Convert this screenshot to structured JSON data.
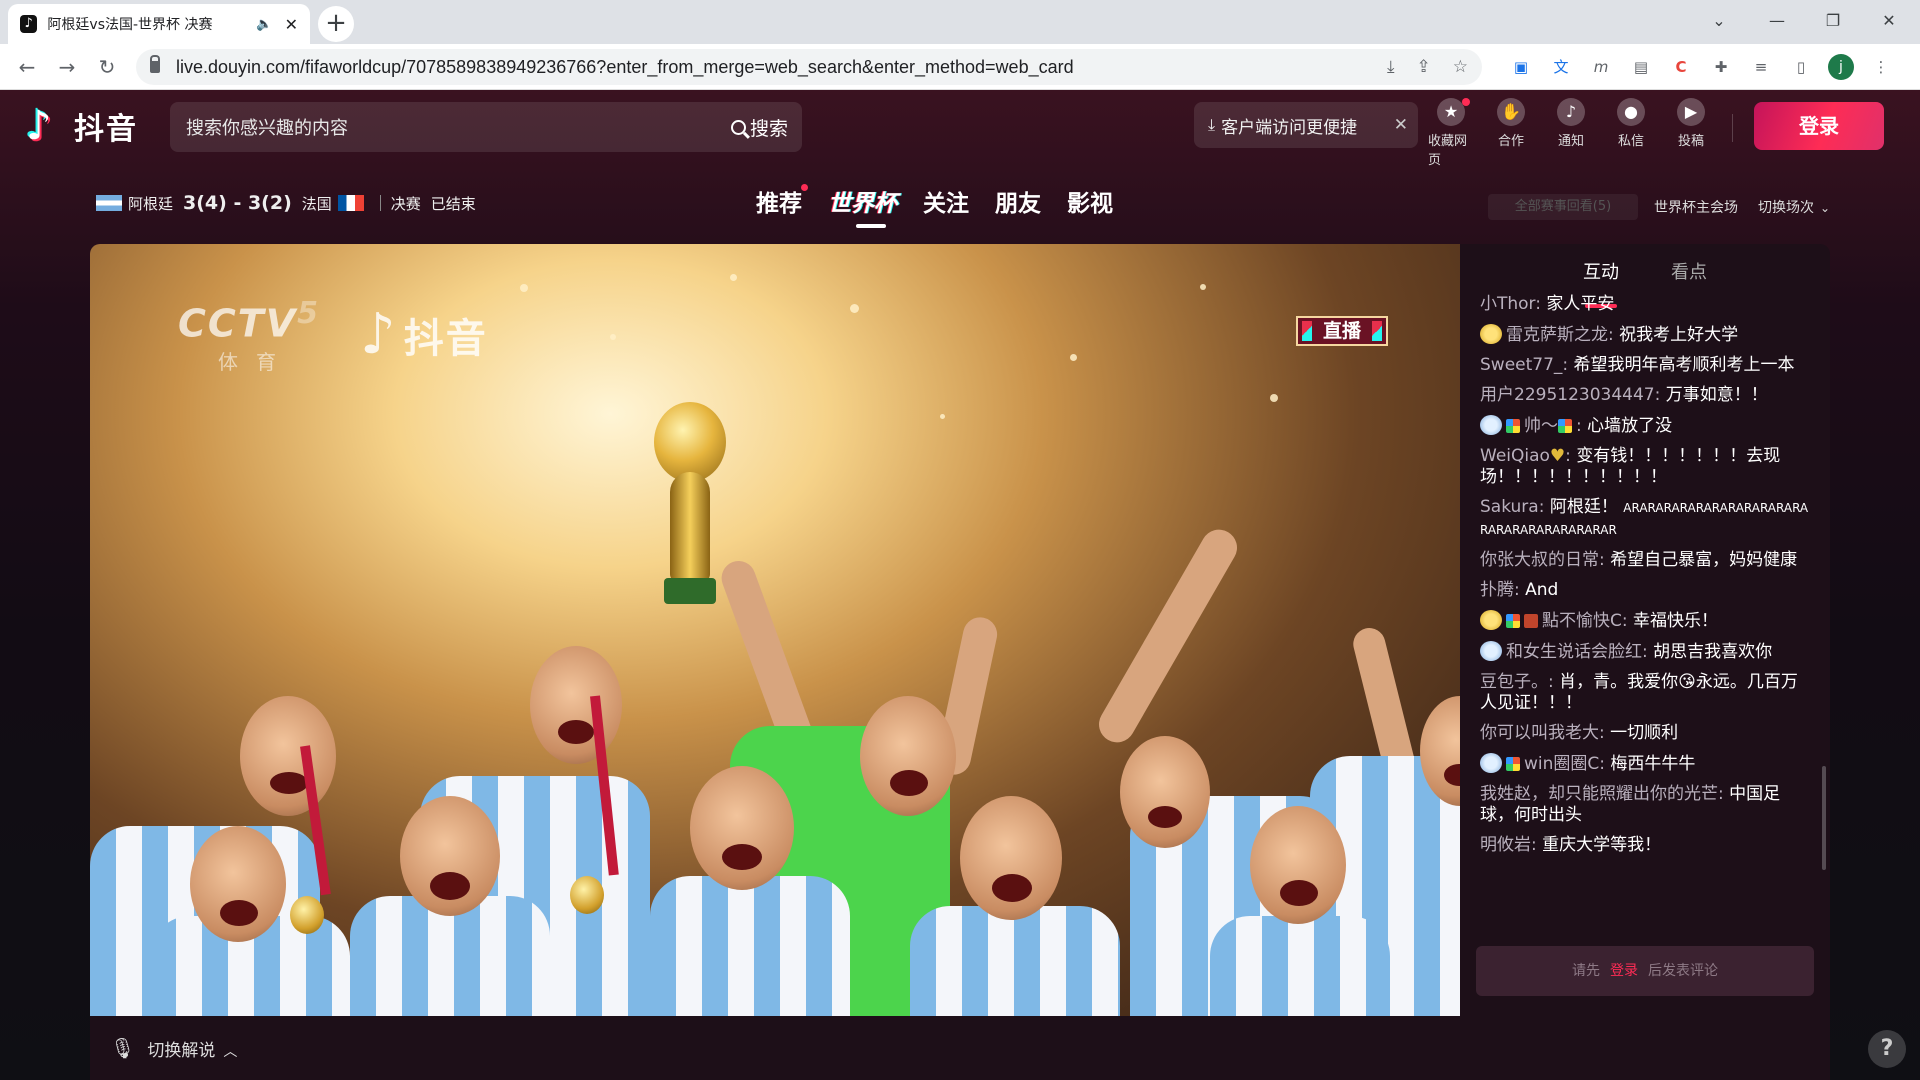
{
  "browser": {
    "tab_title": "阿根廷vs法国-世界杯 决赛",
    "url": "live.douyin.com/fifaworldcup/7078589838949236766?enter_from_merge=web_search&enter_method=web_card",
    "profile_initial": "j"
  },
  "header": {
    "logo_text": "抖音",
    "search_placeholder": "搜索你感兴趣的内容",
    "search_button": "搜索",
    "client_prompt": "客户端访问更便捷",
    "icons": [
      {
        "label": "收藏网页",
        "icon": "star-icon"
      },
      {
        "label": "合作",
        "icon": "handshake-icon"
      },
      {
        "label": "通知",
        "icon": "bell-icon"
      },
      {
        "label": "私信",
        "icon": "message-icon"
      },
      {
        "label": "投稿",
        "icon": "camera-icon"
      }
    ],
    "login_button": "登录"
  },
  "match": {
    "home_team": "阿根廷",
    "score": "3(4) - 3(2)",
    "away_team": "法国",
    "stage": "决赛",
    "status": "已结束"
  },
  "main_tabs": [
    "推荐",
    "世界杯",
    "关注",
    "朋友",
    "影视"
  ],
  "right_nav": {
    "filter": "全部赛事回看(5)",
    "venue": "世界杯主会场",
    "switch": "切换场次"
  },
  "player": {
    "channel_logo": "CCTV",
    "channel_number": "5",
    "channel_sub": "体育",
    "watermark": "抖音",
    "live_badge": "直播",
    "accent": "#fe2c55"
  },
  "chat": {
    "tabs": [
      "互动",
      "看点"
    ],
    "messages": [
      {
        "user": "小Thor:",
        "text": "家人平安"
      },
      {
        "user": "雷克萨斯之龙:",
        "text": "祝我考上好大学"
      },
      {
        "user": "Sweet77_:",
        "text": "希望我明年高考顺利考上一本"
      },
      {
        "user": "用户2295123034447:",
        "text": "万事如意！！"
      },
      {
        "user": "帅～",
        "text": "心墙放了没"
      },
      {
        "user": "WeiQiao",
        "text": "变有钱！！！！！！！去现场！！！！！！！！！！"
      },
      {
        "user": "Sakura:",
        "text": "阿根廷！",
        "small": "ARARARARARARARARARARARARARARARARARARARAR"
      },
      {
        "user": "你张大叔的日常:",
        "text": "希望自己暴富，妈妈健康"
      },
      {
        "user": "扑腾:",
        "text": "And"
      },
      {
        "user": "點不愉快C:",
        "text": "幸福快乐！"
      },
      {
        "user": "和女生说话会脸红:",
        "text": "胡思吉我喜欢你"
      },
      {
        "user": "豆包子。:",
        "text": "肖，青。我爱你😘永远。几百万人见证！！！"
      },
      {
        "user": "你可以叫我老大:",
        "text": "一切顺利"
      },
      {
        "user": "win圈圈C:",
        "text": "梅西牛牛牛"
      },
      {
        "user": "我姓赵，却只能照耀出你的光芒:",
        "text": "中国足球，何时出头"
      },
      {
        "user": "明攸岩:",
        "text": "重庆大学等我！"
      }
    ],
    "input_prefix": "请先",
    "input_login": "登录",
    "input_suffix": "后发表评论"
  },
  "footer": {
    "commentary": "切换解说"
  }
}
